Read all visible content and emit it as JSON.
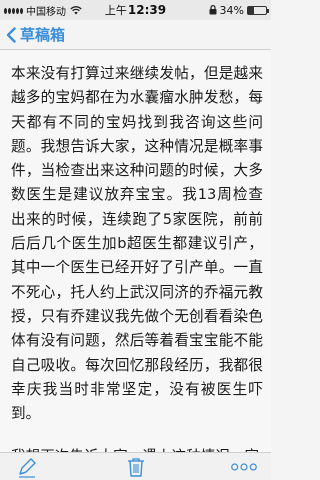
{
  "status_bar": {
    "carrier": "中国移动",
    "time_period": "上午",
    "time": "12:39",
    "battery_percent": "34%",
    "battery_level": 0.34
  },
  "nav": {
    "back_label": "草稿箱"
  },
  "note": {
    "paragraph_1": "本来没有打算过来继续发帖，但是越来越多的宝妈都在为水囊瘤水肿发愁，每天都有不同的宝妈找到我咨询这些问题。我想告诉大家，这种情况是概率事件，当检查出来这种问题的时候，大多数医生是建议放弃宝宝。我13周检查出来的时候，连续跑了5家医院，前前后后几个医生加b超医生都建议引产，其中一个医生已经开好了引产单。一直不死心，托人约上武汉同济的乔福元教授，只有乔建议我先做个无创看看染色体有没有问题，然后等着看宝宝能不能自己吸收。每次回忆那段经历，我都很幸庆我当时非常坚定，没有被医生吓到。",
    "paragraph_2_partial": "我想再次告诉大家，遇上这种情况一定"
  },
  "toolbar": {
    "icons": [
      "compose-icon",
      "trash-icon",
      "more-icon"
    ]
  }
}
